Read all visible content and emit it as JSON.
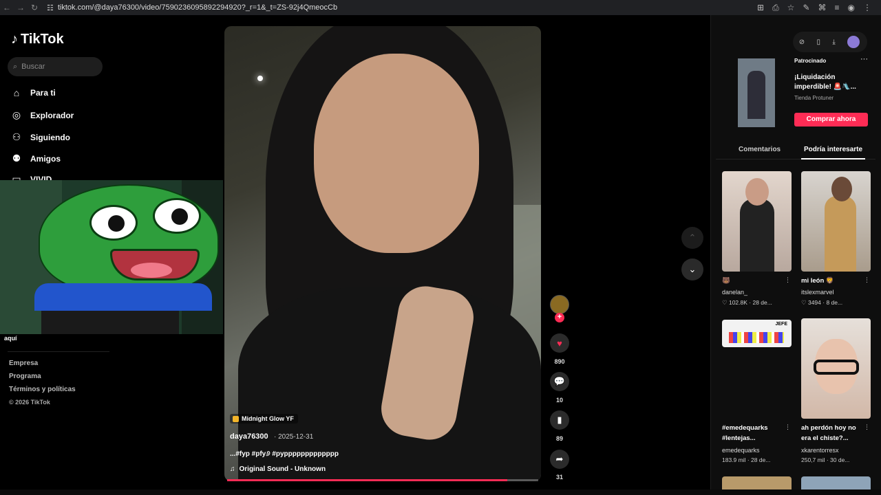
{
  "browser": {
    "url": "tiktok.com/@daya76300/video/7590236095892294920?_r=1&_t=ZS-92j4QmeocCb"
  },
  "sidebar": {
    "logo": "TikTok",
    "search_placeholder": "Buscar",
    "nav": [
      {
        "label": "Para ti",
        "icon": "home-icon"
      },
      {
        "label": "Explorador",
        "icon": "compass-icon"
      },
      {
        "label": "Siguiendo",
        "icon": "following-icon"
      },
      {
        "label": "Amigos",
        "icon": "friends-icon"
      },
      {
        "label": "VIVID",
        "icon": "live-icon"
      }
    ],
    "overlay_caption": "aquí",
    "footer_links": [
      "Empresa",
      "Programa",
      "Términos y políticas"
    ],
    "copyright": "© 2026 TikTok"
  },
  "video": {
    "effect_label": "Midnight Glow YF",
    "author": "daya76300",
    "date": "· 2025-12-31",
    "caption": "...#fyp #pfy୬ #pyppppppppppppp",
    "sound": "Original Sound - Unknown",
    "progress": 0.9
  },
  "actions": {
    "likes": "890",
    "comments": "10",
    "saves": "89",
    "shares": "31"
  },
  "right": {
    "ad_label": "Patrocinado",
    "ad_title": "¡Liquidación imperdible! 🚨🛝...",
    "ad_shop": "Tienda Protuner",
    "ad_button": "Comprar ahora",
    "tab_comments": "Comentarios",
    "tab_interest": "Podría interesarte",
    "cards": [
      {
        "title": "🐻",
        "user": "danelan_",
        "stats": "♡ 102.8K · 28 de..."
      },
      {
        "title": "mi león 🦁",
        "user": "itslexmarvel",
        "stats": "♡ 3494 · 8 de..."
      },
      {
        "title": "#emedequarks #lentejas...",
        "user": "emedequarks",
        "stats": "183.9 mil · 28 de..."
      },
      {
        "title": "ah perdón hoy no era el chiste?...",
        "user": "xkarentorresx",
        "stats": "250,7 mil · 30 de..."
      }
    ],
    "card3_sign": "JEFE"
  },
  "colors": {
    "accent": "#fe2c55",
    "background": "#000000"
  }
}
